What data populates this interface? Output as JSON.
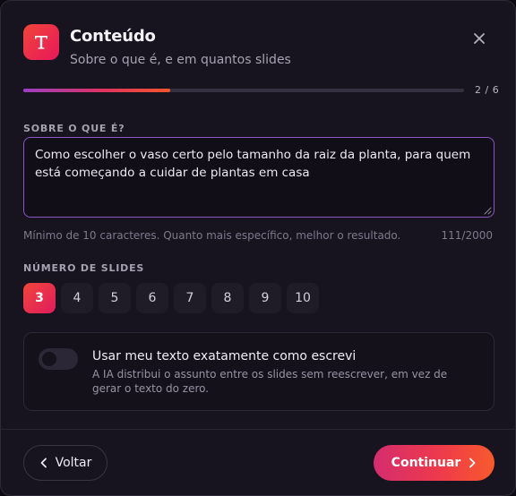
{
  "header": {
    "icon": "text-type-icon",
    "title": "Conteúdo",
    "subtitle": "Sobre o que é, e em quantos slides",
    "close_icon": "close-icon"
  },
  "progress": {
    "current_step": 2,
    "total_steps": 6,
    "label": "2 / 6",
    "fraction": 0.333
  },
  "topic": {
    "label": "SOBRE O QUE É?",
    "value": "Como escolher o vaso certo pelo tamanho da raiz da planta, para quem está começando a cuidar de plantas em casa",
    "hint": "Mínimo de 10 caracteres. Quanto mais específico, melhor o resultado.",
    "char_count": "111/2000"
  },
  "slides": {
    "label": "NÚMERO DE SLIDES",
    "options": [
      "3",
      "4",
      "5",
      "6",
      "7",
      "8",
      "9",
      "10"
    ],
    "selected": "3"
  },
  "exact_text": {
    "enabled": false,
    "title": "Usar meu texto exatamente como escrevi",
    "description": "A IA distribui o assunto entre os slides sem reescrever, em vez de gerar o texto do zero."
  },
  "footer": {
    "back_label": "Voltar",
    "continue_label": "Continuar"
  },
  "colors": {
    "accent_start": "#f0463a",
    "accent_end": "#e01c5e",
    "focus_border": "#8a57c7",
    "background": "#17141f"
  }
}
